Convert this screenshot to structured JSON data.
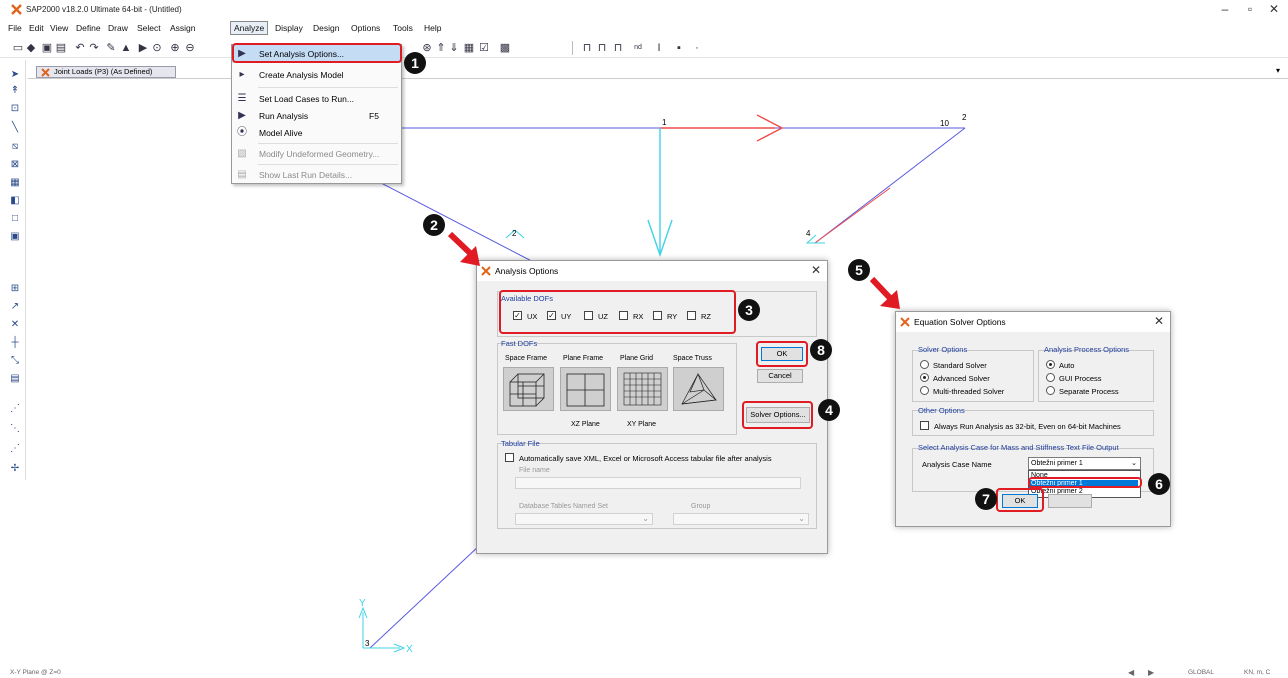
{
  "window": {
    "title": "SAP2000 v18.2.0 Ultimate 64-bit - (Untitled)",
    "minimize": "–",
    "maximize": "▫",
    "close": "✕"
  },
  "menu": [
    "File",
    "Edit",
    "View",
    "Define",
    "Draw",
    "Select",
    "Assign",
    "Analyze",
    "Display",
    "Design",
    "Options",
    "Tools",
    "Help"
  ],
  "toolbar": {
    "dropdown_label": "nd"
  },
  "doc_tab": {
    "label": "Joint Loads (P3) (As Defined)"
  },
  "analyze_menu": {
    "items": [
      {
        "label": "Set Analysis Options...",
        "shortcut": "",
        "icon": "play-settings-icon"
      },
      {
        "label": "Create Analysis Model",
        "shortcut": "",
        "icon": "model-icon"
      },
      {
        "label": "Set Load Cases to Run...",
        "shortcut": "",
        "icon": "list-icon"
      },
      {
        "label": "Run Analysis",
        "shortcut": "F5",
        "icon": "run-icon"
      },
      {
        "label": "Model Alive",
        "shortcut": "",
        "icon": "alive-icon"
      },
      {
        "label": "Modify Undeformed Geometry...",
        "shortcut": "",
        "icon": "geometry-icon"
      },
      {
        "label": "Show Last Run Details...",
        "shortcut": "",
        "icon": "details-icon"
      }
    ]
  },
  "model_labels": {
    "n1": "1",
    "n10": "10",
    "n2": "2",
    "n2b": "2",
    "n4": "4",
    "n3": "3",
    "axis_x": "X",
    "axis_y": "Y"
  },
  "callouts": [
    "1",
    "2",
    "3",
    "4",
    "5",
    "6",
    "7",
    "8"
  ],
  "analysis_options": {
    "title": "Analysis Options",
    "available_dofs_title": "Available DOFs",
    "dofs": [
      {
        "label": "UX",
        "checked": true
      },
      {
        "label": "UY",
        "checked": true
      },
      {
        "label": "UZ",
        "checked": false
      },
      {
        "label": "RX",
        "checked": false
      },
      {
        "label": "RY",
        "checked": false
      },
      {
        "label": "RZ",
        "checked": false
      }
    ],
    "fast_dofs_title": "Fast DOFs",
    "fast_dofs": [
      "Space Frame",
      "Plane Frame",
      "Plane Grid",
      "Space Truss"
    ],
    "plane_labels": [
      "XZ Plane",
      "XY Plane"
    ],
    "ok": "OK",
    "cancel": "Cancel",
    "solver_options": "Solver Options...",
    "tabular_title": "Tabular File",
    "tabular_checkbox": "Automatically save XML, Excel or Microsoft Access tabular file after analysis",
    "file_name_label": "File name",
    "db_tables_label": "Database Tables Named Set",
    "group_label": "Group"
  },
  "solver_options": {
    "title": "Equation Solver Options",
    "solver_group": "Solver Options",
    "solvers": [
      {
        "label": "Standard Solver",
        "selected": false
      },
      {
        "label": "Advanced Solver",
        "selected": true
      },
      {
        "label": "Multi-threaded Solver",
        "selected": false
      }
    ],
    "process_group": "Analysis Process Options",
    "processes": [
      {
        "label": "Auto",
        "selected": true
      },
      {
        "label": "GUI Process",
        "selected": false
      },
      {
        "label": "Separate Process",
        "selected": false
      }
    ],
    "other_group": "Other Options",
    "other_checkbox": "Always Run Analysis as 32-bit, Even on 64-bit Machines",
    "case_group": "Select Analysis Case for Mass and Stiffness Text File Output",
    "case_label": "Analysis Case Name",
    "case_value": "Obtežni primer 1",
    "case_options": [
      "None",
      "Obtežni primer 1",
      "Obtežni primer 2"
    ],
    "ok": "OK"
  },
  "status": {
    "left": "X-Y Plane @ Z=0",
    "coord": "GLOBAL",
    "units": "KN, m, C"
  },
  "colors": {
    "accent_red": "#e01b24",
    "frame_blue": "#5a5ae0",
    "load_cyan": "#3fd3e6",
    "load_red": "#f04c4c"
  }
}
